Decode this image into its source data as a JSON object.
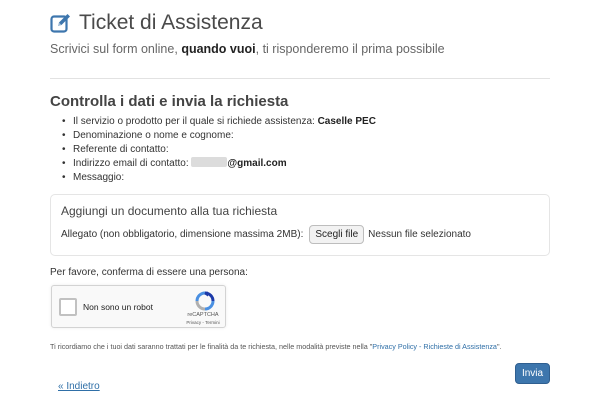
{
  "header": {
    "title": "Ticket di Assistenza",
    "subtitle_pre": "Scrivici sul form online,",
    "subtitle_strong": "quando vuoi",
    "subtitle_post": ", ti risponderemo il prima possibile"
  },
  "summary": {
    "title": "Controlla i dati e invia la richiesta",
    "items": [
      {
        "label": "Il servizio o prodotto per il quale si richiede assistenza:",
        "value": "Caselle PEC"
      },
      {
        "label": "Denominazione o nome e cognome:",
        "value": ""
      },
      {
        "label": "Referente di contatto:",
        "value": ""
      },
      {
        "label": "Indirizzo email di contatto:",
        "value": "@gmail.com"
      },
      {
        "label": "Messaggio:",
        "value": ""
      }
    ]
  },
  "upload": {
    "title": "Aggiungi un documento alla tua richiesta",
    "label": "Allegato (non obbligatorio, dimensione massima 2MB):",
    "button_label": "Scegli file",
    "status": "Nessun file selezionato"
  },
  "captcha": {
    "prompt": "Per favore, conferma di essere una persona:",
    "checkbox_label": "Non sono un robot",
    "brand": "reCAPTCHA",
    "privacy": "Privacy",
    "terms": "Termini",
    "separator": " - "
  },
  "privacy": {
    "text_pre": "Ti ricordiamo che i tuoi dati saranno trattati per le finalità da te richiesta, nelle modalità previste nella \"",
    "link": "Privacy Policy - Richieste di Assistenza",
    "text_post": "\"."
  },
  "actions": {
    "submit_label": "Invia",
    "back_label": "« Indietro"
  },
  "colors": {
    "accent": "#3d76ad",
    "link": "#2f6fa7"
  },
  "icons": {
    "title": "edit-icon",
    "captcha": "recaptcha-logo-icon"
  }
}
